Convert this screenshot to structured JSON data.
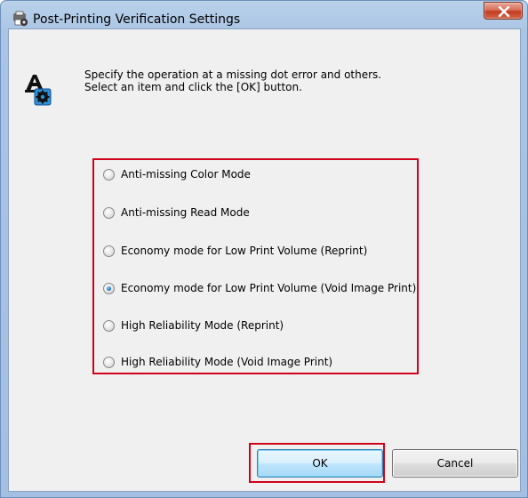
{
  "window": {
    "title": "Post-Printing Verification Settings"
  },
  "instructions": {
    "line1": "Specify the operation at a missing dot error and others.",
    "line2": "Select an item and click the [OK] button."
  },
  "options": [
    {
      "label": "Anti-missing Color Mode",
      "selected": false
    },
    {
      "label": "Anti-missing Read Mode",
      "selected": false
    },
    {
      "label": "Economy mode for Low Print Volume (Reprint)",
      "selected": false
    },
    {
      "label": "Economy mode for Low Print Volume (Void Image Print)",
      "selected": true
    },
    {
      "label": "High Reliability Mode (Reprint)",
      "selected": false
    },
    {
      "label": "High Reliability Mode (Void Image Print)",
      "selected": false
    }
  ],
  "buttons": {
    "ok_label": "OK",
    "cancel_label": "Cancel"
  },
  "colors": {
    "highlight": "#d0021b",
    "titlebar": "#b9d1ea",
    "dialog_bg": "#f0f0f0"
  },
  "icons": {
    "title": "printer-gear-icon",
    "header": "print-settings-gear-icon",
    "close": "close-icon"
  }
}
